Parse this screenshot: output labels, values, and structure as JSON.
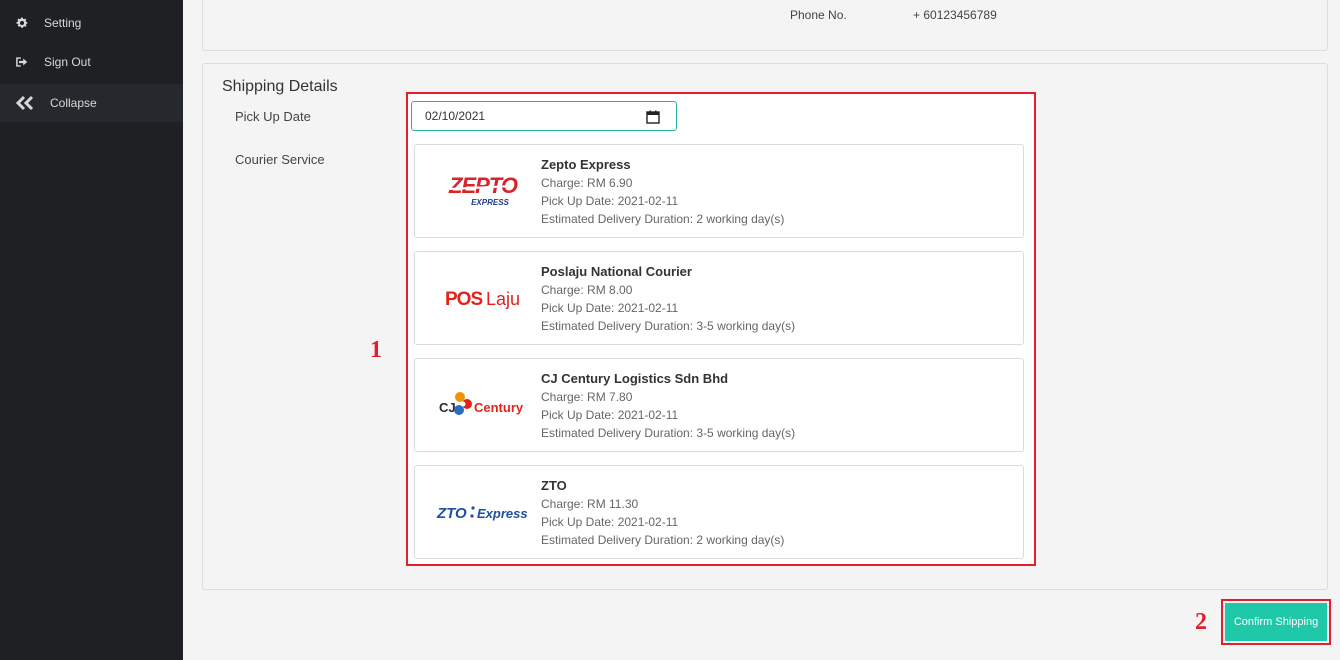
{
  "sidebar": {
    "items": [
      {
        "label": "Setting",
        "icon": "gear-icon"
      },
      {
        "label": "Sign Out",
        "icon": "sign-out-icon"
      },
      {
        "label": "Collapse",
        "icon": "double-chevron-left-icon"
      }
    ]
  },
  "contact": {
    "phone_label": "Phone No.",
    "phone_value": "+ 60123456789"
  },
  "shipping": {
    "title": "Shipping Details",
    "pickup_label": "Pick Up Date",
    "courier_label": "Courier Service",
    "pickup_date": "02/10/2021",
    "couriers": [
      {
        "name": "Zepto Express",
        "charge": "Charge: RM 6.90",
        "pickup": "Pick Up Date: 2021-02-11",
        "duration": "Estimated Delivery Duration: 2 working day(s)",
        "logo_main": "ZEPTO",
        "logo_sub": "EXPRESS"
      },
      {
        "name": "Poslaju National Courier",
        "charge": "Charge: RM 8.00",
        "pickup": "Pick Up Date: 2021-02-11",
        "duration": "Estimated Delivery Duration: 3-5 working day(s)",
        "logo_main": "POS",
        "logo_sub": "Laju"
      },
      {
        "name": "CJ Century Logistics Sdn Bhd",
        "charge": "Charge: RM 7.80",
        "pickup": "Pick Up Date: 2021-02-11",
        "duration": "Estimated Delivery Duration: 3-5 working day(s)",
        "logo_main": "CJ",
        "logo_sub": "Century"
      },
      {
        "name": "ZTO",
        "charge": "Charge: RM 11.30",
        "pickup": "Pick Up Date: 2021-02-11",
        "duration": "Estimated Delivery Duration: 2 working day(s)",
        "logo_main": "ZTO",
        "logo_sub": "Express"
      }
    ]
  },
  "actions": {
    "confirm_label": "Confirm Shipping"
  },
  "annotations": {
    "marker_1": "1",
    "marker_2": "2"
  },
  "colors": {
    "accent": "#1fc8a8",
    "highlight": "#e0202a",
    "sidebar_bg": "#1e2023"
  }
}
